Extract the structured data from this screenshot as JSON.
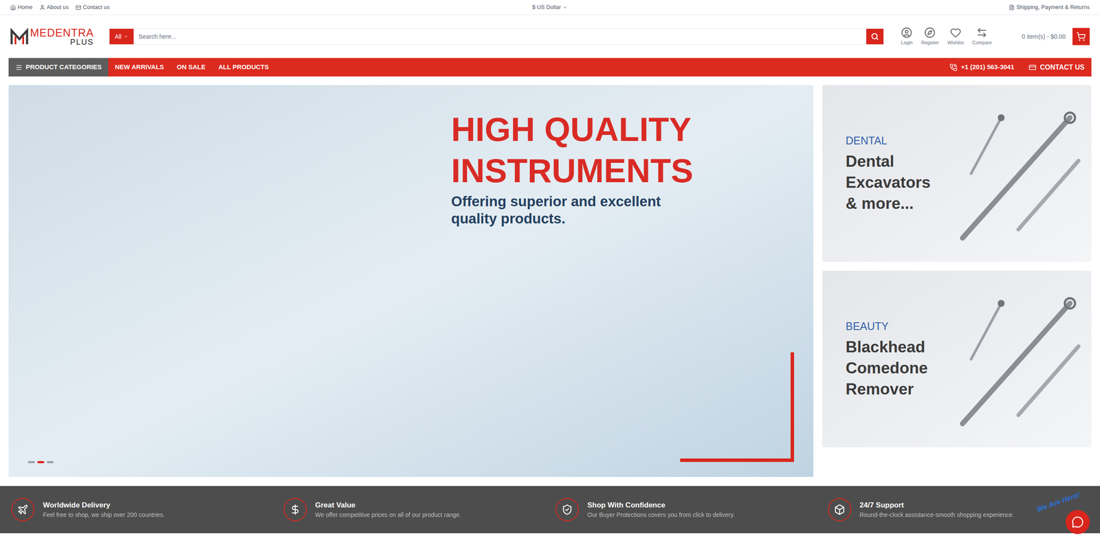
{
  "topbar": {
    "links": [
      "Home",
      "About us",
      "Contact us"
    ],
    "currency": "$ US Dollar",
    "shipping": "Shipping, Payment & Returns"
  },
  "logo": {
    "name": "MEDENTRA",
    "sub": "PLUS"
  },
  "search": {
    "category": "All",
    "placeholder": "Search here..."
  },
  "account": [
    "Login",
    "Register",
    "Wishlist",
    "Compare"
  ],
  "cart": {
    "summary": "0 item(s) - $0.00"
  },
  "nav": {
    "categories": "PRODUCT CATEGORIES",
    "items": [
      "NEW ARRIVALS",
      "ON SALE",
      "ALL PRODUCTS"
    ],
    "phone": "+1 (201) 563-3041",
    "contact": "CONTACT US"
  },
  "hero": {
    "title_lines": [
      "HIGH QUALITY",
      "INSTRUMENTS"
    ],
    "subtitle_lines": [
      "Offering superior and excellent",
      "quality products."
    ],
    "slides": [
      {
        "selected": false
      },
      {
        "selected": true
      },
      {
        "selected": false
      }
    ]
  },
  "promos": [
    {
      "category": "DENTAL",
      "title_lines": [
        "Dental",
        "Excavators",
        "& more..."
      ]
    },
    {
      "category": "BEAUTY",
      "title_lines": [
        "Blackhead",
        "Comedone",
        "Remover"
      ]
    }
  ],
  "features": [
    {
      "title": "Worldwide Delivery",
      "text": "Feel free to shop, we ship over 200 countries."
    },
    {
      "title": "Great Value",
      "text": "We offer competitive prices on all of our product range."
    },
    {
      "title": "Shop With Confidence",
      "text": "Our Buyer Protections covers you from click to delivery."
    },
    {
      "title": "24/7 Support",
      "text": "Round-the-clock assistance-smooth shopping experience."
    }
  ],
  "chat": {
    "badge": "We Are Here!"
  }
}
